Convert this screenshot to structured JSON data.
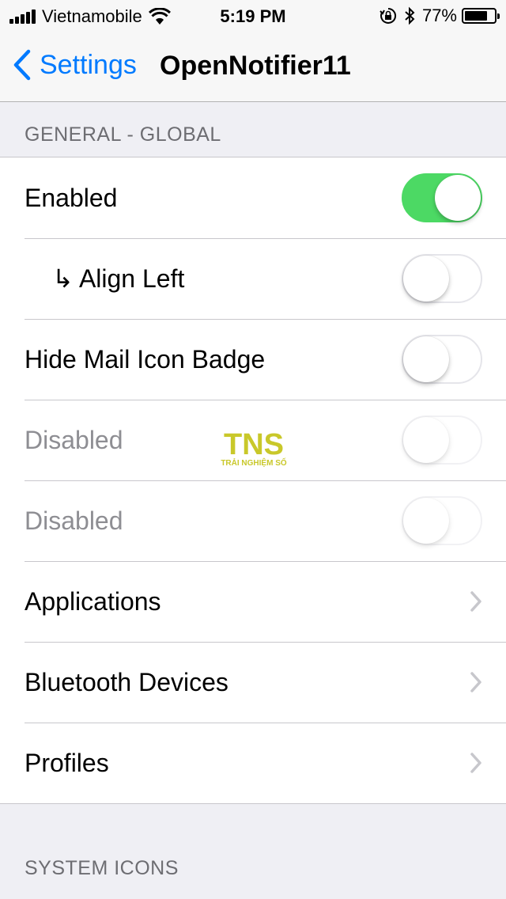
{
  "status_bar": {
    "carrier": "Vietnamobile",
    "time": "5:19 PM",
    "battery": "77%",
    "battery_level": 0.77,
    "icons": [
      "signal-icon",
      "wifi-icon",
      "orientation-lock-icon",
      "bluetooth-icon",
      "battery-icon"
    ]
  },
  "nav": {
    "back_label": "Settings",
    "title": "OpenNotifier11"
  },
  "sections": [
    {
      "header": "GENERAL - GLOBAL",
      "rows": [
        {
          "label": "Enabled",
          "type": "switch",
          "on": true
        },
        {
          "label": "Align Left",
          "prefix": "↳",
          "type": "switch",
          "on": false
        },
        {
          "label": "Hide Mail Icon Badge",
          "type": "switch",
          "on": false
        },
        {
          "label": "Disabled",
          "type": "switch",
          "on": false,
          "disabled": true
        },
        {
          "label": "Disabled",
          "type": "switch",
          "on": false,
          "disabled": true
        },
        {
          "label": "Applications",
          "type": "disclosure"
        },
        {
          "label": "Bluetooth Devices",
          "type": "disclosure"
        },
        {
          "label": "Profiles",
          "type": "disclosure"
        }
      ]
    },
    {
      "header": "SYSTEM ICONS"
    }
  ],
  "watermark": {
    "logo": "TNS",
    "tagline": "TRẢI NGHIỆM SỐ",
    "color": "#c9c82a"
  },
  "colors": {
    "accent": "#007aff",
    "switch_on": "#4cd964",
    "background": "#efeff4"
  }
}
